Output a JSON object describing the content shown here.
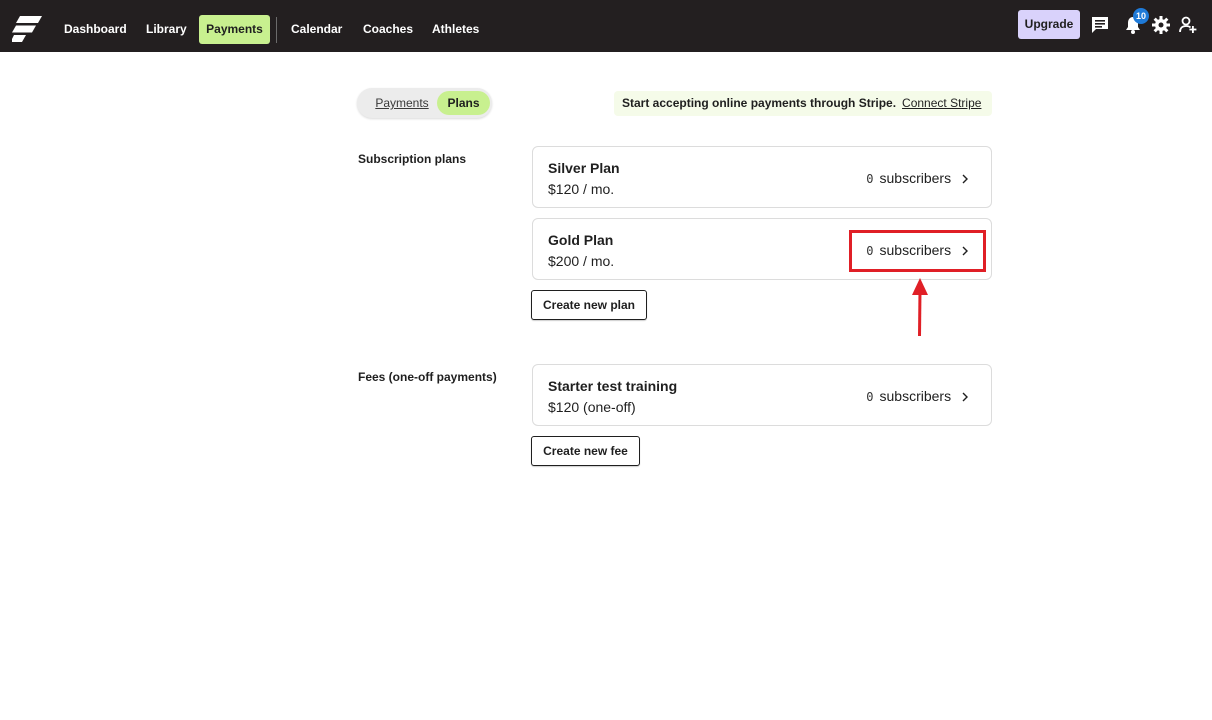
{
  "topbar": {
    "nav": [
      {
        "label": "Dashboard"
      },
      {
        "label": "Library"
      },
      {
        "label": "Payments"
      },
      {
        "label": "Calendar"
      },
      {
        "label": "Coaches"
      },
      {
        "label": "Athletes"
      }
    ],
    "upgrade_label": "Upgrade",
    "notifications_count": "10",
    "icons": [
      "logo-icon",
      "chat-icon",
      "bell-icon",
      "gear-icon",
      "user-add-icon"
    ]
  },
  "toggle": {
    "payments_label": "Payments",
    "plans_label": "Plans"
  },
  "stripe": {
    "text": "Start accepting online payments through Stripe.",
    "link": "Connect Stripe"
  },
  "subscription": {
    "label": "Subscription plans",
    "plans": [
      {
        "name": "Silver Plan",
        "price": "$120 / mo.",
        "count": "0",
        "subs": "subscribers"
      },
      {
        "name": "Gold Plan",
        "price": "$200 / mo.",
        "count": "0",
        "subs": "subscribers"
      }
    ],
    "create_label": "Create new plan"
  },
  "fees": {
    "label": "Fees (one-off payments)",
    "items": [
      {
        "name": "Starter test training",
        "price": "$120 (one-off)",
        "count": "0",
        "subs": "subscribers"
      }
    ],
    "create_label": "Create new fee"
  },
  "colors": {
    "topbar": "#231f20",
    "accent": "#c8f08f",
    "upgrade": "#d9d2fb",
    "badge": "#1e7ad8",
    "annotation": "#e01f26"
  }
}
